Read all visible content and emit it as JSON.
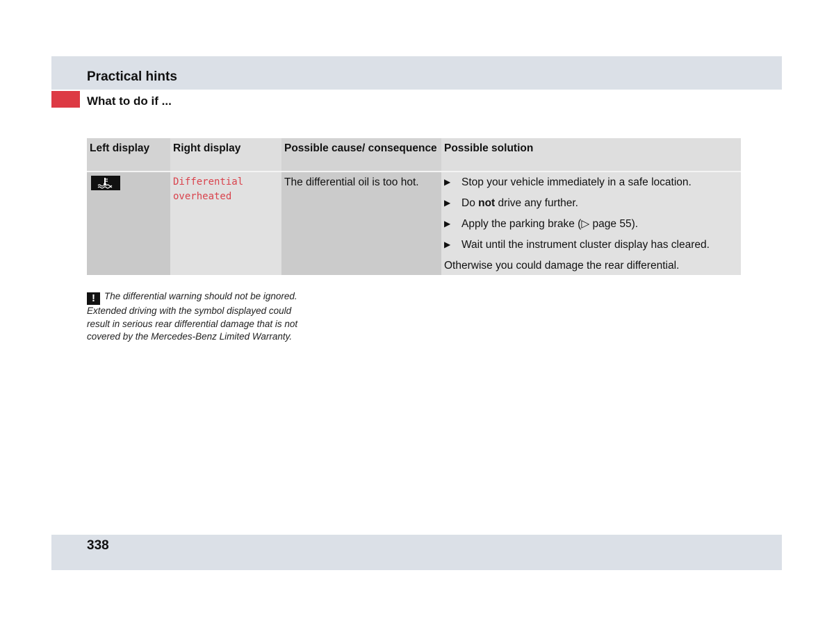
{
  "header": {
    "section_title": "Practical hints",
    "sub_title": "What to do if ..."
  },
  "table": {
    "columns": [
      "Left display",
      "Right display",
      "Possible cause/ consequence",
      "Possible solution"
    ],
    "rows": [
      {
        "left_display_icon": "differential-temperature-icon",
        "right_display": "Differential\noverheated",
        "cause": "The differential oil is too hot.",
        "solution_steps": [
          {
            "text": "Stop your vehicle immediately in a safe location."
          },
          {
            "pre": "Do ",
            "bold": "not",
            "post": " drive any further."
          },
          {
            "text": "Apply the parking brake (▷ page 55)."
          },
          {
            "text": "Wait until the instrument cluster display has cleared."
          }
        ],
        "solution_note": "Otherwise you could damage the rear differential."
      }
    ]
  },
  "note": {
    "icon": "!",
    "text": "The differential warning should not be ignored. Extended driving with the symbol displayed could result in serious rear differential damage that is not covered by the Mercedes-Benz Limited Warranty."
  },
  "footer": {
    "page_number": "338"
  },
  "colors": {
    "band": "#dbe0e7",
    "accent_red": "#dd3a44",
    "display_text_red": "#d9434d"
  }
}
